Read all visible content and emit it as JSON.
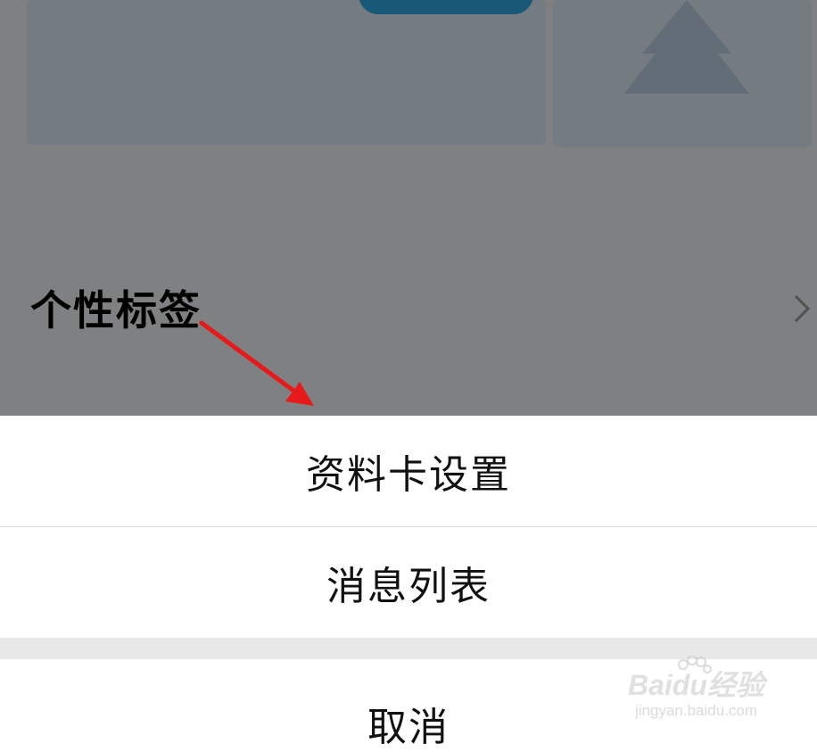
{
  "background": {
    "section_title": "个性标签"
  },
  "action_sheet": {
    "items": [
      {
        "label": "资料卡设置"
      },
      {
        "label": "消息列表"
      }
    ],
    "cancel_label": "取消"
  },
  "watermark": {
    "brand": "Baidu经验",
    "url": "jingyan.baidu.com"
  },
  "colors": {
    "overlay": "#000000",
    "annotation_arrow": "#e8191a",
    "accent": "#2aa6df"
  }
}
